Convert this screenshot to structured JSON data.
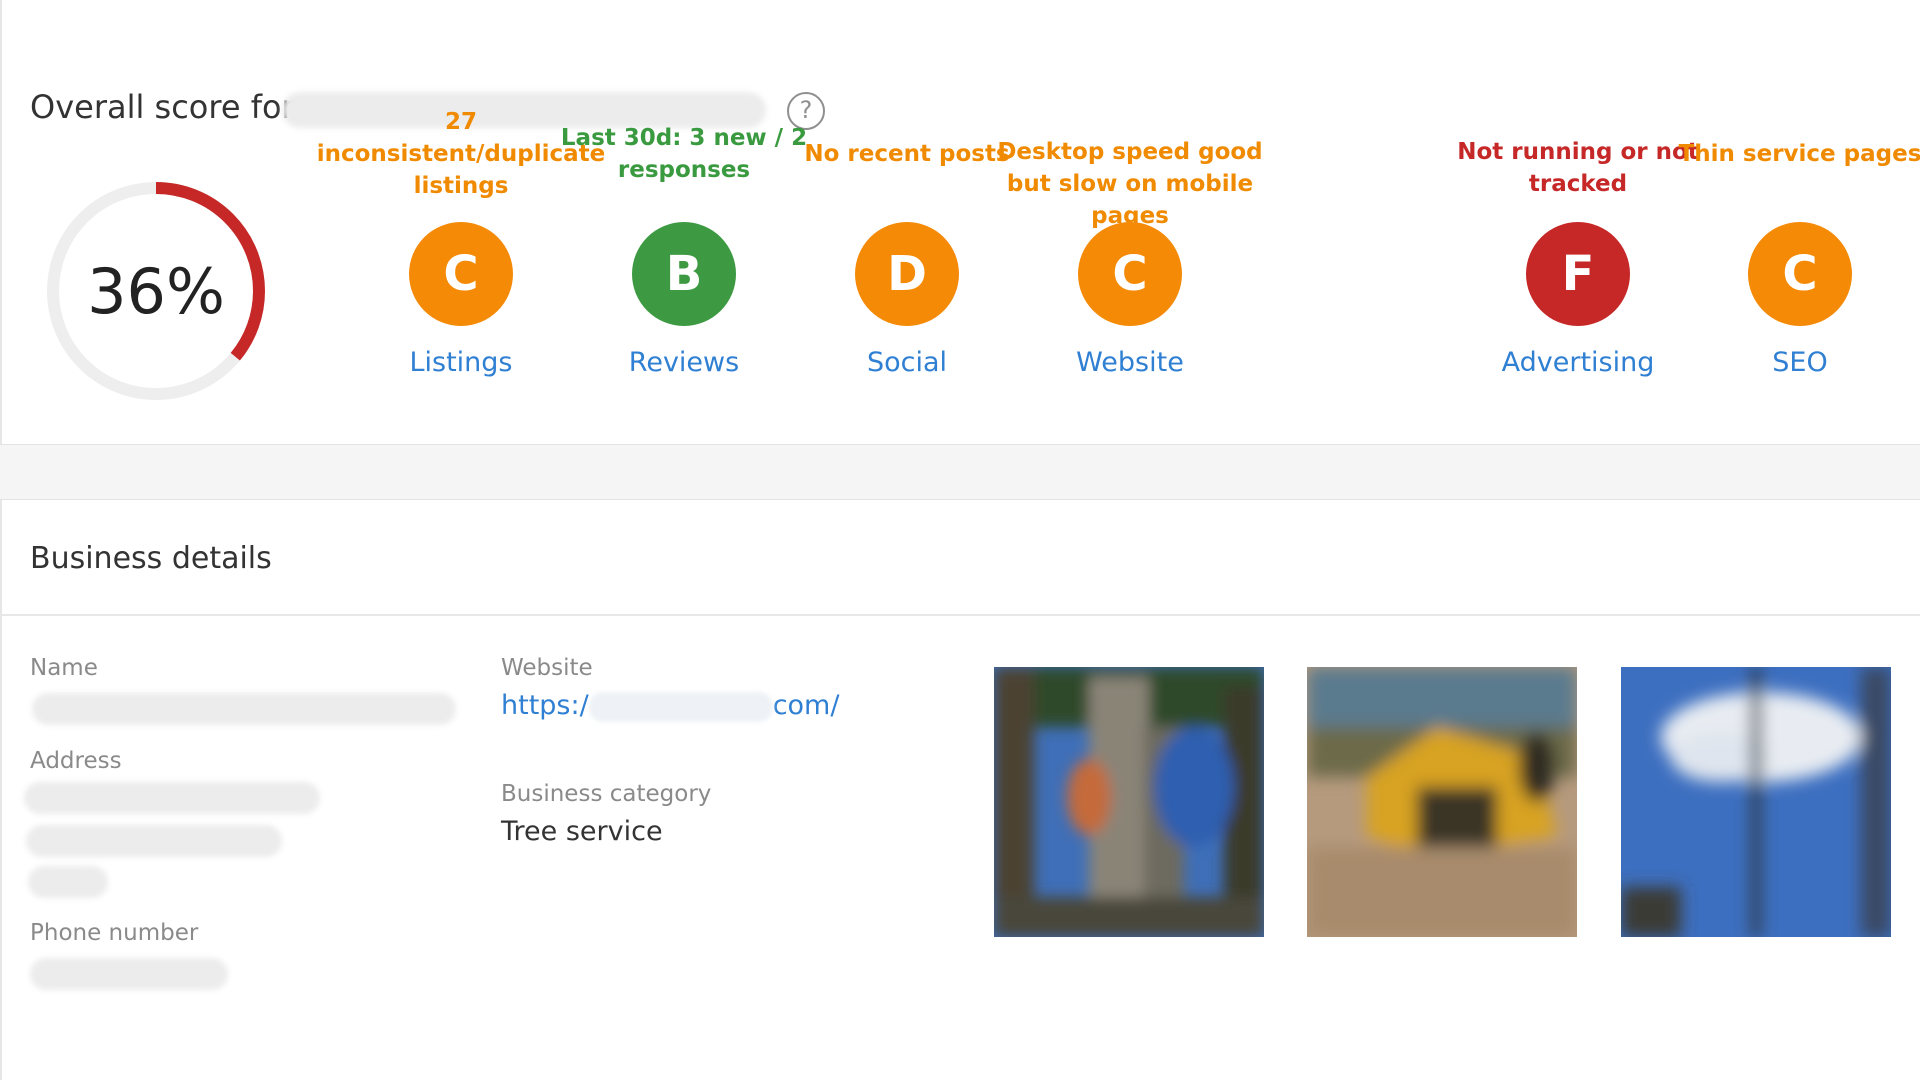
{
  "score": {
    "title": "Overall score for",
    "value": "36%",
    "percent": 36,
    "ring_color": "#c62828",
    "track_color": "#eeeeee",
    "help_icon": "question-circle-icon",
    "help_glyph": "?"
  },
  "categories": [
    {
      "note": "27 inconsistent/duplicate listings",
      "note_color": "#f08a00",
      "grade": "C",
      "grade_color": "#f58a07",
      "label": "Listings"
    },
    {
      "note": "Last 30d: 3 new / 2 responses",
      "note_color": "#3a9a3f",
      "grade": "B",
      "grade_color": "#3d9a42",
      "label": "Reviews"
    },
    {
      "note": "No recent posts",
      "note_color": "#f08a00",
      "grade": "D",
      "grade_color": "#f58a07",
      "label": "Social"
    },
    {
      "note": "Desktop speed good but slow on mobile pages",
      "note_color": "#f08a00",
      "grade": "C",
      "grade_color": "#f58a07",
      "label": "Website"
    },
    {
      "note": "Not running or not tracked",
      "note_color": "#c62828",
      "grade": "F",
      "grade_color": "#c62828",
      "label": "Advertising"
    },
    {
      "note": "Thin service pages",
      "note_color": "#f08a00",
      "grade": "C",
      "grade_color": "#f58a07",
      "label": "SEO"
    }
  ],
  "business": {
    "title": "Business details",
    "name_label": "Name",
    "address_label": "Address",
    "phone_label": "Phone number",
    "website_label": "Website",
    "website_prefix": "https:/",
    "website_suffix": "com/",
    "category_label": "Business category",
    "category_value": "Tree service"
  }
}
